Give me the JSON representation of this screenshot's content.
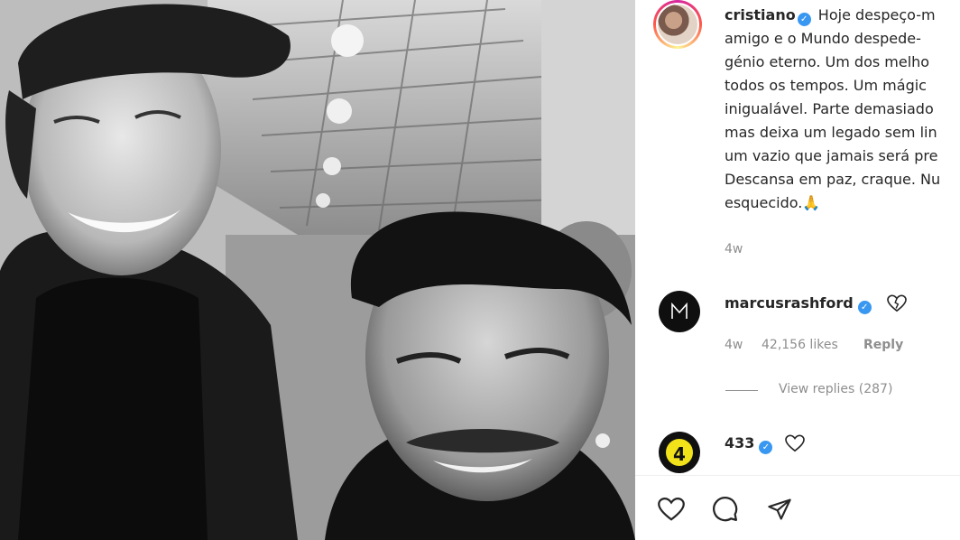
{
  "post": {
    "author": "cristiano",
    "caption_lines": [
      "Hoje despeço-m",
      "amigo e o Mundo despede-",
      "génio eterno. Um dos melho",
      "todos os tempos. Um mágic",
      "inigualável. Parte demasiado",
      "mas deixa um legado sem lin",
      "um vazio que jamais será pre",
      "Descansa em paz, craque. Nu",
      "esquecido.🙏"
    ],
    "time": "4w"
  },
  "comments": [
    {
      "user": "marcusrashford",
      "badge": "💔",
      "time": "4w",
      "likes": "42,156 likes",
      "reply": "Reply",
      "view_replies": "View replies (287)"
    },
    {
      "user": "433",
      "avatar_text": "4"
    }
  ],
  "icons": {
    "verified": "✓",
    "like": "heart-icon",
    "comment": "comment-icon",
    "share": "share-icon"
  },
  "colors": {
    "verified_blue": "#3897f0",
    "muted_text": "#8e8e8e"
  }
}
